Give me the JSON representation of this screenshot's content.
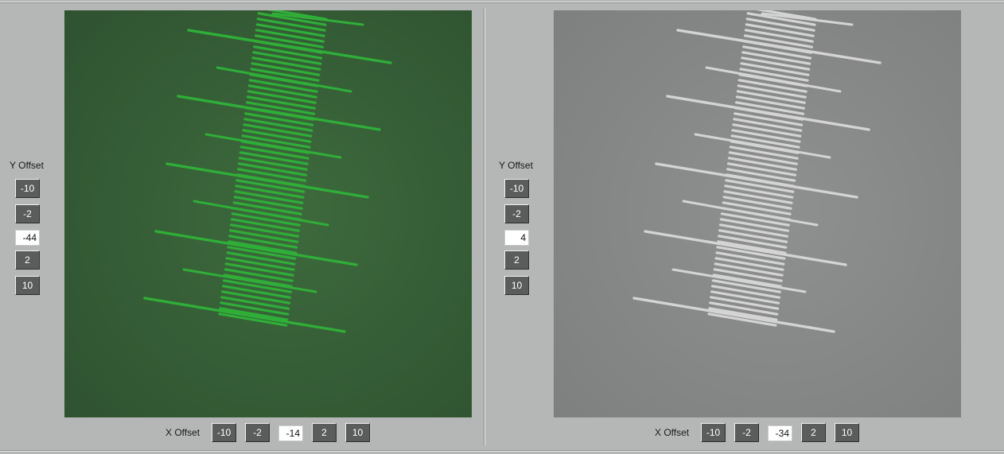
{
  "left_panel": {
    "y_offset_label": "Y Offset",
    "y_buttons": {
      "minus10": "-10",
      "minus2": "-2",
      "plus2": "2",
      "plus10": "10"
    },
    "y_value": "-44",
    "x_offset_label": "X Offset",
    "x_buttons": {
      "minus10": "-10",
      "minus2": "-2",
      "plus2": "2",
      "plus10": "10"
    },
    "x_value": "-14",
    "image_tint": "#2f5230"
  },
  "right_panel": {
    "y_offset_label": "Y Offset",
    "y_buttons": {
      "minus10": "-10",
      "minus2": "-2",
      "plus2": "2",
      "plus10": "10"
    },
    "y_value": "4",
    "x_offset_label": "X Offset",
    "x_buttons": {
      "minus10": "-10",
      "minus2": "-2",
      "plus2": "2",
      "plus10": "10"
    },
    "x_value": "-34",
    "image_tint": "#7e7f7f"
  },
  "colors": {
    "background": "#b4b7b6",
    "button": "#5a5d5c",
    "green_line": "#2fae38",
    "gray_line": "#d4d4d4"
  }
}
